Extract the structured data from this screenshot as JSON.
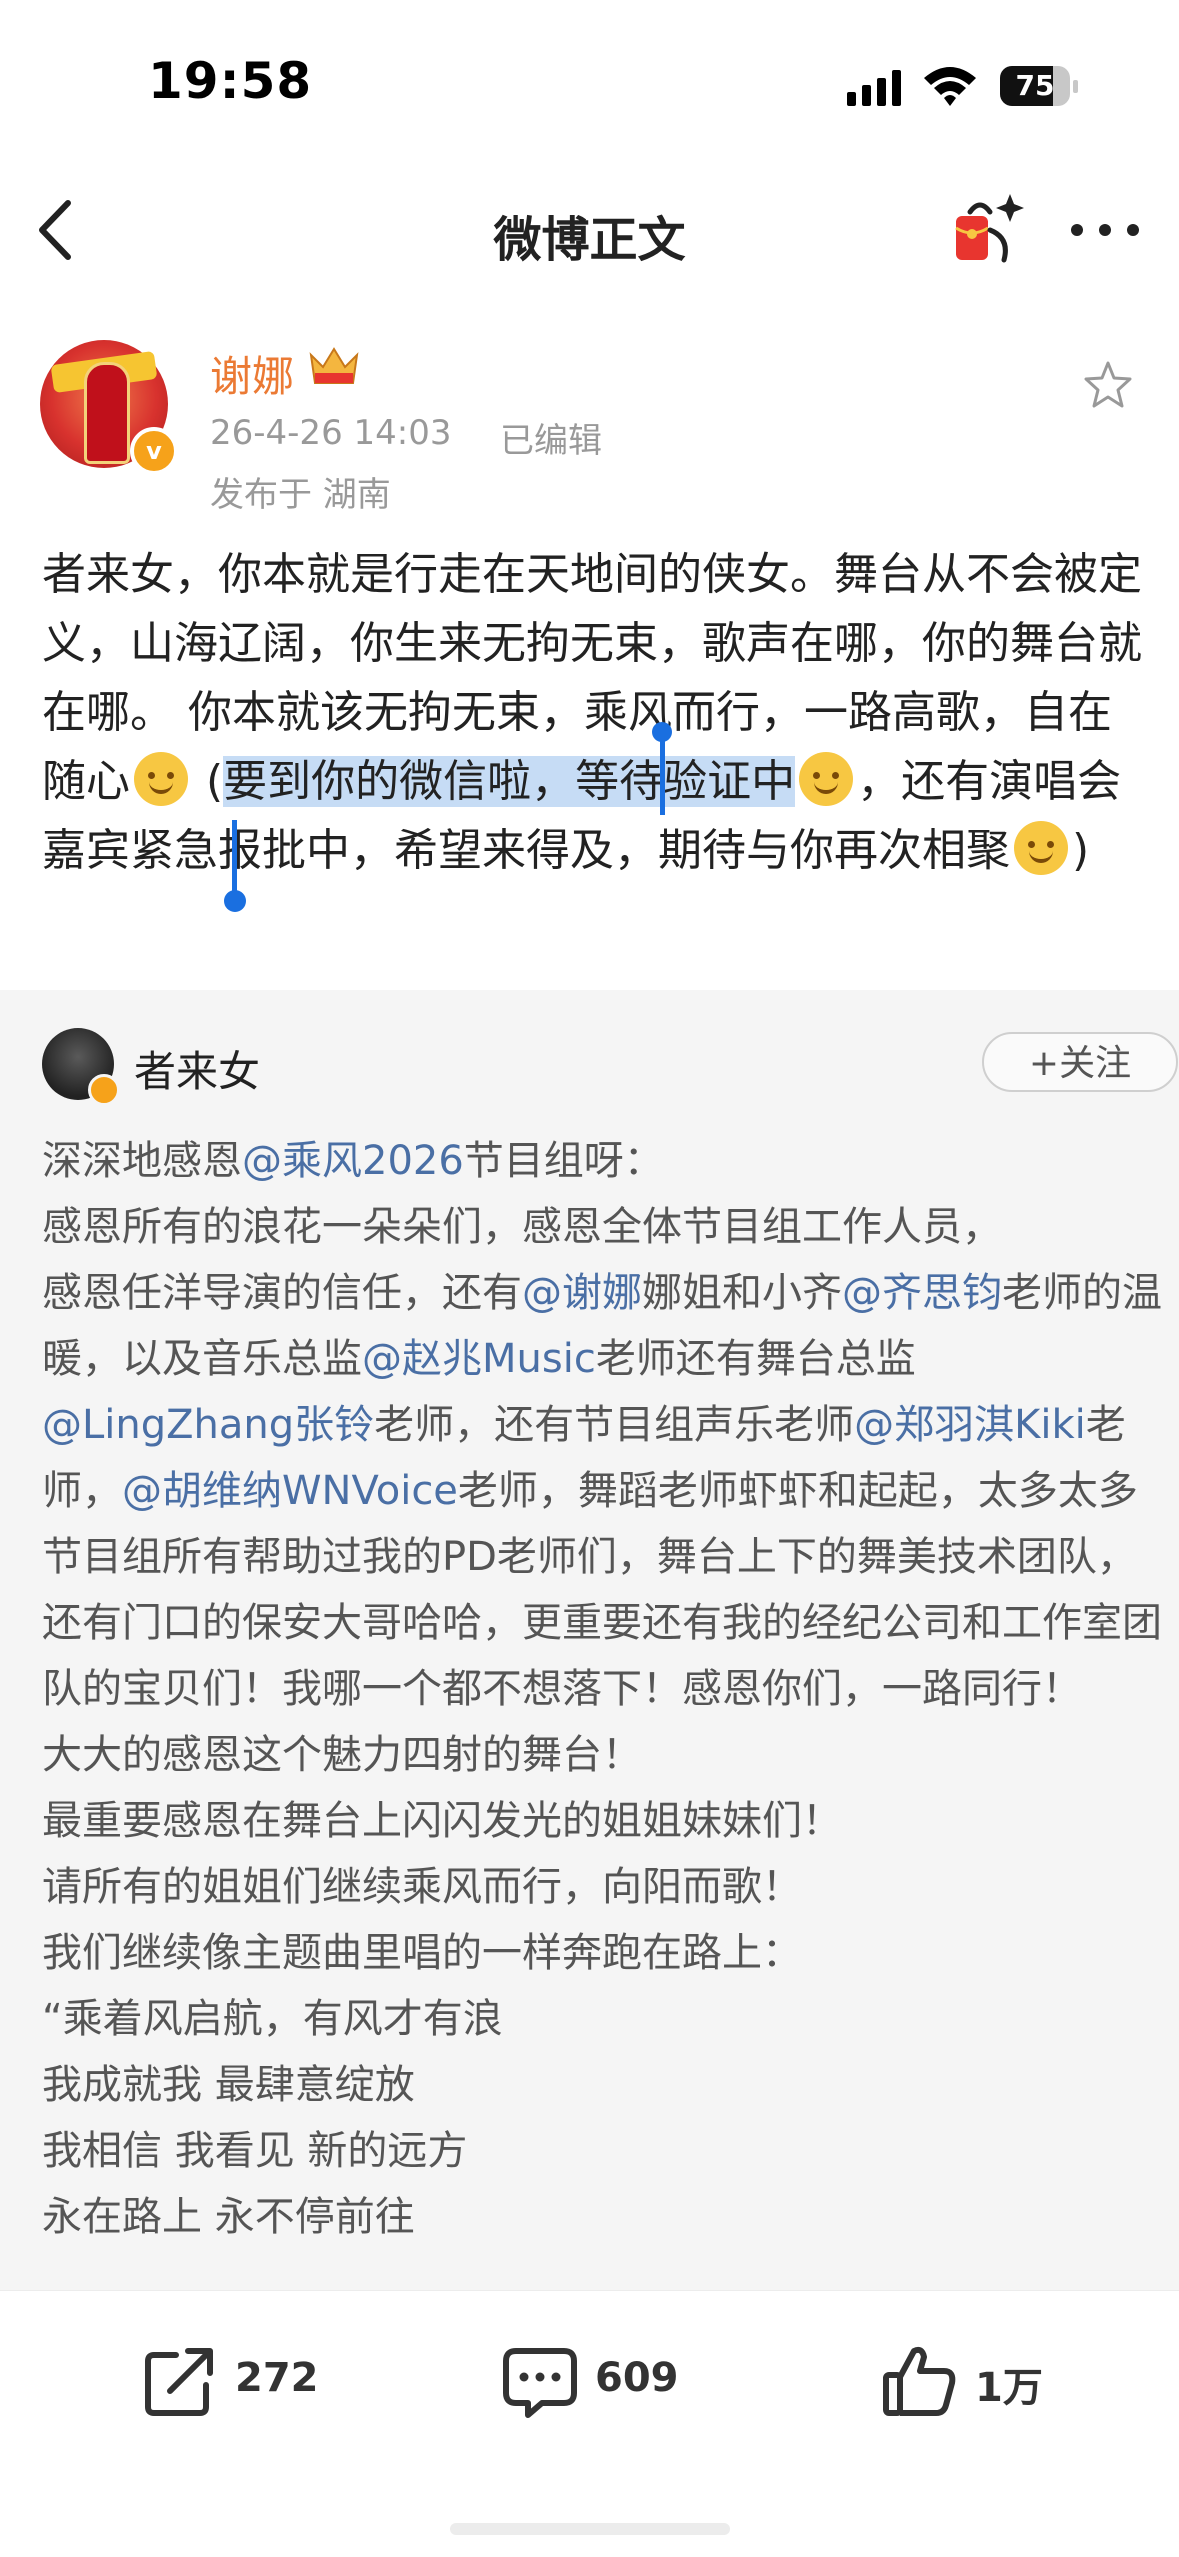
{
  "status_bar": {
    "time": "19:58",
    "battery": "75",
    "battery_level_percent": 75
  },
  "nav": {
    "title": "微博正文"
  },
  "author": {
    "name": "谢娜",
    "time": "26-4-26 14:03",
    "edited": "已编辑",
    "location": "发布于 湖南"
  },
  "post": {
    "text_part1": "者来女，你本就是行走在天地间的侠女。舞台从不会被定义，山海辽阔，你生来无拘无束，歌声在哪，你的舞台就在哪。 你本就该无拘无束，乘风而行，一路高歌，自在随心",
    "text_part2": " (",
    "text_selected": "要到你的微信啦，等待验证中",
    "text_part3": "，还有演唱会嘉宾紧急报批中，希望来得及，期待与你再次相聚",
    "text_part4": ")"
  },
  "repost": {
    "author": "者来女",
    "follow_label": "+关注",
    "l1a": "深深地感恩",
    "l1m": "@乘风2026",
    "l1b": "节目组呀：",
    "l2": "感恩所有的浪花一朵朵们，感恩全体节目组工作人员，",
    "l3a": "感恩任洋导演的信任，还有",
    "l3m": "@谢娜",
    "l3b": "娜姐和小齐",
    "l3m2": "@齐思钧",
    "l4a": "老师的温暖，以及音乐总监",
    "l4m": "@赵兆Music",
    "l4b": "老师还有",
    "l5a": "舞台总监",
    "l5m": "@LingZhang张铃",
    "l5b": "老师，还有节目组声乐老师",
    "l6m": "@郑羽淇Kiki",
    "l6a": "老师，",
    "l6m2": "@胡维纳WNVoice",
    "l6b": "老师，舞蹈老师虾虾和起起，太多太多节目组所有帮助过我的PD老师们，舞台上下的舞美技术团队，还有门口的保安大哥哈哈，更重要还有我的经纪公司和工作室团队的宝贝们！我哪一个都不想落下！感恩你们，一路同行！",
    "l7": "大大的感恩这个魅力四射的舞台！",
    "l8": "最重要感恩在舞台上闪闪发光的姐姐妹妹们！",
    "l9": "请所有的姐姐们继续乘风而行，向阳而歌！",
    "l10": "我们继续像主题曲里唱的一样奔跑在路上：",
    "l11": "“乘着风启航，有风才有浪",
    "l12": "我成就我 最肆意绽放",
    "l13": "我相信 我看见 新的远方",
    "l14": "永在路上 永不停前往"
  },
  "toolbar": {
    "reposts": "272",
    "comments": "609",
    "likes": "1万"
  },
  "colors": {
    "accent_name": "#eb7a34",
    "mention": "#4a6fa5",
    "selection": "#c6dcf5",
    "handle": "#1a6fe0"
  }
}
